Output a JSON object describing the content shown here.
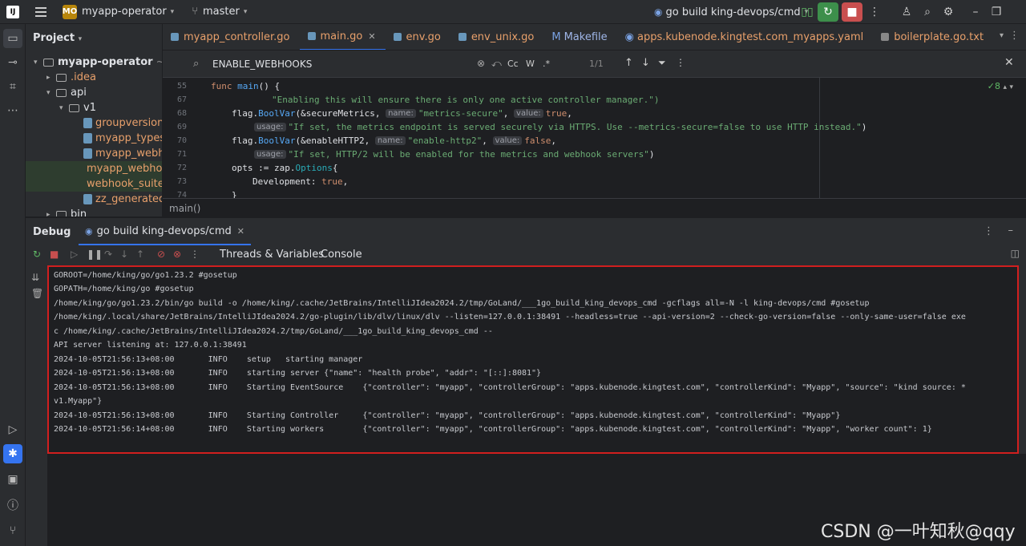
{
  "titlebar": {
    "logo": "IJ",
    "project_badge": "MO",
    "project_name": "myapp-operator",
    "branch": "master",
    "run_config": "go build king-devops/cmd"
  },
  "project_panel": {
    "title": "Project",
    "root": "myapp-operator",
    "root_path": "~/wo",
    "items": [
      {
        "label": ".idea",
        "depth": 1,
        "type": "folder",
        "expanded": false
      },
      {
        "label": "api",
        "depth": 1,
        "type": "folder",
        "expanded": true
      },
      {
        "label": "v1",
        "depth": 2,
        "type": "folder",
        "expanded": true
      },
      {
        "label": "groupversion_ir",
        "depth": 3,
        "type": "file"
      },
      {
        "label": "myapp_types.go",
        "depth": 3,
        "type": "file"
      },
      {
        "label": "myapp_webhoo",
        "depth": 3,
        "type": "file"
      },
      {
        "label": "myapp_webhoo",
        "depth": 3,
        "type": "file"
      },
      {
        "label": "webhook_suite",
        "depth": 3,
        "type": "file"
      },
      {
        "label": "zz_generated.d",
        "depth": 3,
        "type": "file"
      },
      {
        "label": "bin",
        "depth": 1,
        "type": "folder",
        "expanded": false
      }
    ]
  },
  "editor_tabs": [
    {
      "label": "myapp_controller.go",
      "active": false
    },
    {
      "label": "main.go",
      "active": true
    },
    {
      "label": "env.go",
      "active": false
    },
    {
      "label": "env_unix.go",
      "active": false
    },
    {
      "label": "Makefile",
      "active": false
    },
    {
      "label": "apps.kubenode.kingtest.com_myapps.yaml",
      "active": false
    },
    {
      "label": "boilerplate.go.txt",
      "active": false
    }
  ],
  "search": {
    "query": "ENABLE_WEBHOOKS",
    "match_count": "1/1",
    "opt_case": "Cc",
    "opt_word": "W",
    "opt_regex": ".*"
  },
  "editor": {
    "inspection_count": "8",
    "breadcrumb": "main()",
    "lines": {
      "n55": "55",
      "l55_kw": "func ",
      "l55_fn": "main",
      "l55_rest": "() {",
      "n67": "67",
      "l67_str": "\"Enabling this will ensure there is only one active controller manager.\")",
      "n68": "68",
      "l68_a": "flag.",
      "l68_fn": "BoolVar",
      "l68_b": "(&secureMetrics, ",
      "l68_h1": "name:",
      "l68_s1": "\"metrics-secure\"",
      "l68_c": ", ",
      "l68_h2": "value:",
      "l68_v": "true",
      "l68_d": ",",
      "n69": "69",
      "l69_h": "usage:",
      "l69_s": "\"If set, the metrics endpoint is served securely via HTTPS. Use --metrics-secure=false to use HTTP instead.\"",
      "l69_e": ")",
      "n70": "70",
      "l70_a": "flag.",
      "l70_fn": "BoolVar",
      "l70_b": "(&enableHTTP2, ",
      "l70_h1": "name:",
      "l70_s1": "\"enable-http2\"",
      "l70_c": ", ",
      "l70_h2": "value:",
      "l70_v": "false",
      "l70_d": ",",
      "n71": "71",
      "l71_h": "usage:",
      "l71_s": "\"If set, HTTP/2 will be enabled for the metrics and webhook servers\"",
      "l71_e": ")",
      "n72": "72",
      "l72_a": "opts := zap.",
      "l72_ty": "Options",
      "l72_b": "{",
      "n73": "73",
      "l73_a": "Development: ",
      "l73_v": "true",
      "l73_b": ",",
      "n74": "74",
      "l74_a": "}"
    }
  },
  "debug": {
    "title": "Debug",
    "session_tab": "go build king-devops/cmd",
    "subtabs": [
      "Threads & Variables",
      "Console"
    ]
  },
  "console_lines": [
    "GOROOT=/home/king/go/go1.23.2 #gosetup",
    "GOPATH=/home/king/go #gosetup",
    "/home/king/go/go1.23.2/bin/go build -o /home/king/.cache/JetBrains/IntelliJIdea2024.2/tmp/GoLand/___1go_build_king_devops_cmd -gcflags all=-N -l king-devops/cmd #gosetup",
    "/home/king/.local/share/JetBrains/IntelliJIdea2024.2/go-plugin/lib/dlv/linux/dlv --listen=127.0.0.1:38491 --headless=true --api-version=2 --check-go-version=false --only-same-user=false exe",
    "c /home/king/.cache/JetBrains/IntelliJIdea2024.2/tmp/GoLand/___1go_build_king_devops_cmd --",
    "API server listening at: 127.0.0.1:38491",
    "2024-10-05T21:56:13+08:00       INFO    setup   starting manager",
    "2024-10-05T21:56:13+08:00       INFO    starting server {\"name\": \"health probe\", \"addr\": \"[::]:8081\"}",
    "2024-10-05T21:56:13+08:00       INFO    Starting EventSource    {\"controller\": \"myapp\", \"controllerGroup\": \"apps.kubenode.kingtest.com\", \"controllerKind\": \"Myapp\", \"source\": \"kind source: *",
    "v1.Myapp\"}",
    "2024-10-05T21:56:13+08:00       INFO    Starting Controller     {\"controller\": \"myapp\", \"controllerGroup\": \"apps.kubenode.kingtest.com\", \"controllerKind\": \"Myapp\"}",
    "2024-10-05T21:56:14+08:00       INFO    Starting workers        {\"controller\": \"myapp\", \"controllerGroup\": \"apps.kubenode.kingtest.com\", \"controllerKind\": \"Myapp\", \"worker count\": 1}"
  ],
  "watermark": "CSDN @一叶知秋@qqy",
  "colors": {
    "accent": "#3574f0",
    "run": "#3d8f4b",
    "stop": "#c94f4f",
    "highlight_border": "#d11f1f"
  }
}
